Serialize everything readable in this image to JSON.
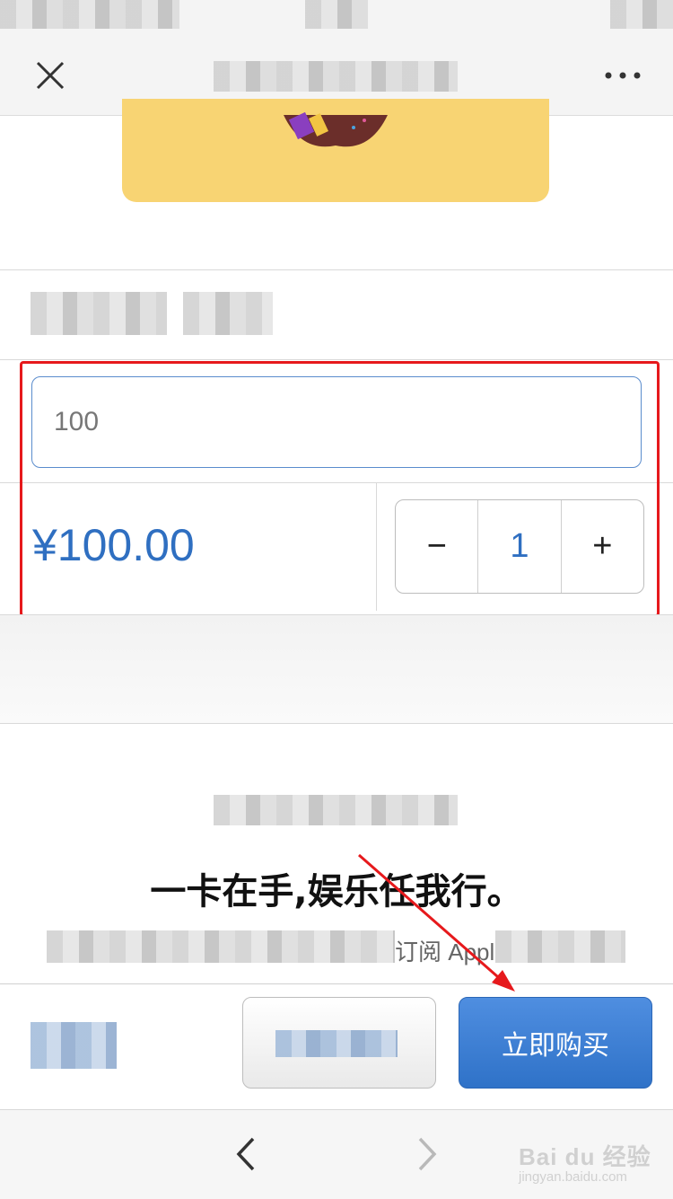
{
  "header": {
    "close_icon": "close-icon",
    "more_icon": "more-icon"
  },
  "amount_input": {
    "value": "100"
  },
  "price": "¥100.00",
  "stepper": {
    "minus": "−",
    "quantity": "1",
    "plus": "+"
  },
  "promo": {
    "slogan": "一卡在手,娱乐任我行。",
    "desc_visible": "订阅 Appl"
  },
  "buy_bar": {
    "buy_now_label": "立即购买"
  },
  "toolbar": {
    "back_icon": "chevron-left-icon",
    "forward_icon": "chevron-right-icon"
  },
  "watermark": {
    "brand": "Bai du 经验",
    "url": "jingyan.baidu.com"
  },
  "colors": {
    "accent": "#2f6fc1",
    "highlight": "#e6191c",
    "card": "#f8d473"
  }
}
